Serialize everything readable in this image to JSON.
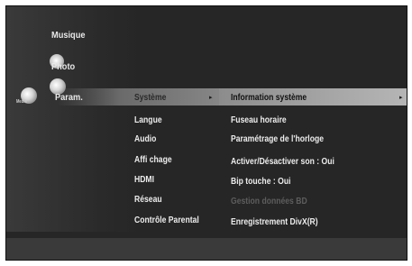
{
  "main_menu": {
    "items": [
      {
        "label": "Musique"
      },
      {
        "label": "Photo"
      },
      {
        "label": "Param."
      }
    ],
    "icon_caption": "Media"
  },
  "sub_menu": {
    "selected": "Système",
    "items": [
      "Langue",
      "Audio",
      "Affi chage",
      "HDMI",
      "Réseau",
      "Contrôle Parental"
    ]
  },
  "options": {
    "selected": "Information système",
    "items": [
      {
        "label": "Fuseau horaire",
        "state": "normal"
      },
      {
        "label": "Paramétrage de l'horloge",
        "state": "normal"
      },
      {
        "label": "Activer/Désactiver son :  Oui",
        "state": "normal"
      },
      {
        "label": "Bip touche  :  Oui",
        "state": "normal"
      },
      {
        "label": "Gestion données BD",
        "state": "disabled"
      },
      {
        "label": "Enregistrement DivX(R)",
        "state": "normal"
      }
    ]
  },
  "indicators": {
    "sub_arrow": "▸",
    "opt_arrow": "▸"
  }
}
